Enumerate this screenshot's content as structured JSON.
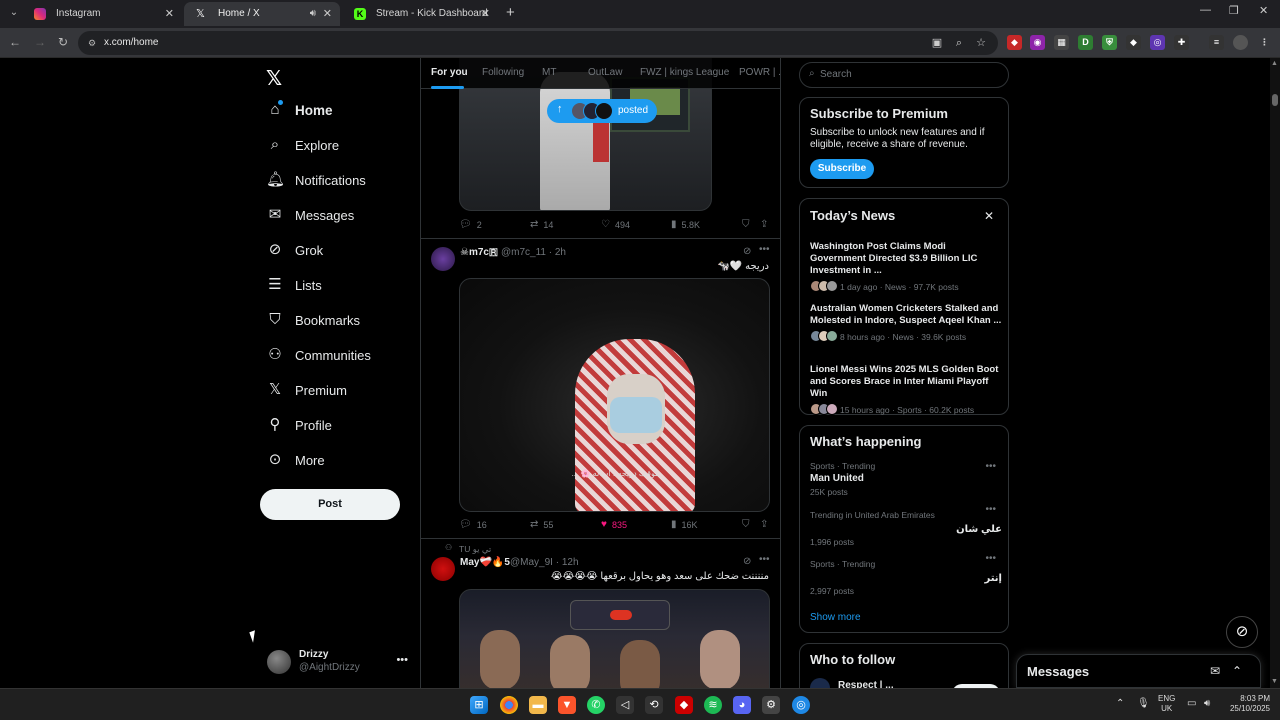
{
  "browser": {
    "tabs": [
      {
        "title": "Instagram",
        "favicon_color": "#e1306c"
      },
      {
        "title": "Home / X",
        "favicon_color": "#ffffff"
      },
      {
        "title": "Stream - Kick Dashboard",
        "favicon_color": "#53fc18"
      }
    ],
    "url": "x.com/home"
  },
  "nav": {
    "items": [
      {
        "label": "Home",
        "icon": "home-icon"
      },
      {
        "label": "Explore",
        "icon": "search-icon"
      },
      {
        "label": "Notifications",
        "icon": "bell-icon"
      },
      {
        "label": "Messages",
        "icon": "mail-icon"
      },
      {
        "label": "Grok",
        "icon": "grok-icon"
      },
      {
        "label": "Lists",
        "icon": "list-icon"
      },
      {
        "label": "Bookmarks",
        "icon": "bookmark-icon"
      },
      {
        "label": "Communities",
        "icon": "communities-icon"
      },
      {
        "label": "Premium",
        "icon": "x-logo-icon"
      },
      {
        "label": "Profile",
        "icon": "person-icon"
      },
      {
        "label": "More",
        "icon": "more-circle-icon"
      }
    ],
    "post_label": "Post",
    "profile": {
      "name": "Drizzy",
      "handle": "@AightDrizzy"
    }
  },
  "feed": {
    "tabs": [
      "For you",
      "Following",
      "MT",
      "OutLaw",
      "FWZ | kings League",
      "POWR | ..."
    ],
    "posted_pill": "posted",
    "tweets": [
      {
        "replies": "2",
        "reposts": "14",
        "likes": "494",
        "views": "5.8K"
      },
      {
        "name": "☠m7c🇷",
        "handle": "@m7c_11 · 2h",
        "text": "دريجه 🤍🐄",
        "media_caption": "موقف دريجه ، اسانه 🌸 ...",
        "replies": "16",
        "reposts": "55",
        "likes": "835",
        "views": "16K"
      },
      {
        "context": "تي يو TU",
        "name": "May❤️‍🩹🔥5",
        "handle": "@May_9I · 12h",
        "text": "مننننت ضحك على سعد وهو يحاول برقعها 😭😭😭😭"
      }
    ]
  },
  "sidebar": {
    "search_placeholder": "Search",
    "premium": {
      "title": "Subscribe to Premium",
      "desc": "Subscribe to unlock new features and if eligible, receive a share of revenue.",
      "button": "Subscribe"
    },
    "news": {
      "title": "Today’s News",
      "items": [
        {
          "title": "Washington Post Claims Modi Government Directed $3.9 Billion LIC Investment in ...",
          "meta": "1 day ago · News · 97.7K posts"
        },
        {
          "title": "Australian Women Cricketers Stalked and Molested in Indore, Suspect Aqeel Khan ...",
          "meta": "8 hours ago · News · 39.6K posts"
        },
        {
          "title": "Lionel Messi Wins 2025 MLS Golden Boot and Scores Brace in Inter Miami Playoff Win",
          "meta": "15 hours ago · Sports · 60.2K posts"
        }
      ]
    },
    "happening": {
      "title": "What’s happening",
      "items": [
        {
          "category": "Sports · Trending",
          "name": "Man United",
          "posts": "25K posts"
        },
        {
          "category": "Trending in United Arab Emirates",
          "name": "علي شان",
          "posts": "1,996 posts"
        },
        {
          "category": "Sports · Trending",
          "name": "إنتر",
          "posts": "2,997 posts"
        }
      ],
      "show_more": "Show more"
    },
    "who_to_follow": {
      "title": "Who to follow",
      "first_name": "Respect | ..."
    }
  },
  "messages_drawer": {
    "title": "Messages"
  },
  "taskbar": {
    "lang": "ENG",
    "region": "UK",
    "time": "8:03 PM",
    "date": "25/10/2025"
  },
  "colors": {
    "accent": "#1d9bf0",
    "like": "#f91880",
    "bg": "#000000",
    "muted": "#71767b"
  }
}
